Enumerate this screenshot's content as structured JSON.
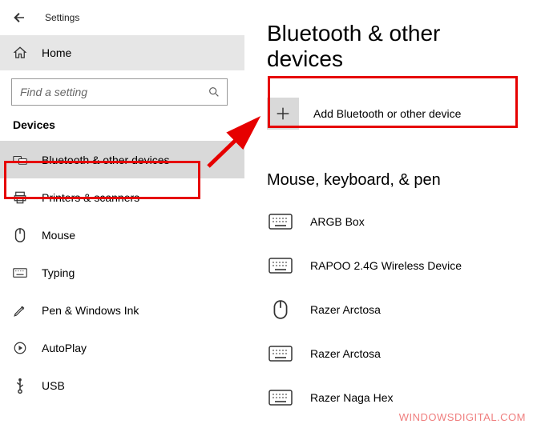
{
  "titlebar": {
    "title": "Settings"
  },
  "home": {
    "label": "Home"
  },
  "search": {
    "placeholder": "Find a setting"
  },
  "section": {
    "label": "Devices"
  },
  "nav": {
    "items": [
      {
        "label": "Bluetooth & other devices",
        "icon": "bluetooth-devices-icon",
        "selected": true
      },
      {
        "label": "Printers & scanners",
        "icon": "printer-icon"
      },
      {
        "label": "Mouse",
        "icon": "mouse-icon"
      },
      {
        "label": "Typing",
        "icon": "keyboard-icon"
      },
      {
        "label": "Pen & Windows Ink",
        "icon": "pen-icon"
      },
      {
        "label": "AutoPlay",
        "icon": "autoplay-icon"
      },
      {
        "label": "USB",
        "icon": "usb-icon"
      }
    ]
  },
  "page": {
    "title": "Bluetooth & other devices",
    "add_label": "Add Bluetooth or other device",
    "group_title": "Mouse, keyboard, & pen",
    "devices": [
      {
        "label": "ARGB Box",
        "icon": "keyboard"
      },
      {
        "label": "RAPOO 2.4G Wireless Device",
        "icon": "keyboard"
      },
      {
        "label": "Razer Arctosa",
        "icon": "mouse"
      },
      {
        "label": "Razer Arctosa",
        "icon": "keyboard"
      },
      {
        "label": "Razer Naga Hex",
        "icon": "keyboard"
      }
    ]
  },
  "watermark": "WINDOWSDIGITAL.COM"
}
